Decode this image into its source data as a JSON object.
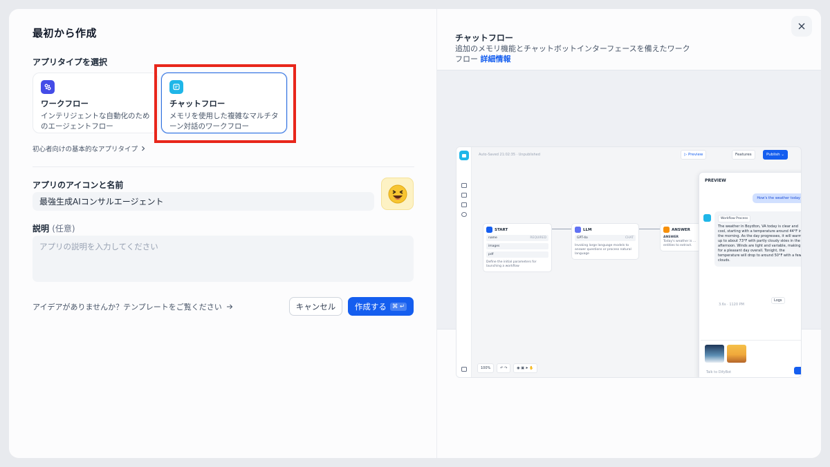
{
  "dialog": {
    "title": "最初から作成",
    "app_type_label": "アプリタイプを選択",
    "app_types": [
      {
        "name": "ワークフロー",
        "desc_line1": "インテリジェントな自動化のため",
        "desc_line2": "のエージェントフロー"
      },
      {
        "name": "チャットフロー",
        "desc_line1": "メモリを使用した複雑なマルチタ",
        "desc_line2": "ーン対話のワークフロー"
      }
    ],
    "beginner_link": "初心者向けの基本的なアプリタイプ",
    "icon_name_label": "アプリのアイコンと名前",
    "app_name_value": "最強生成AIコンサルエージェント",
    "emoji": "😆",
    "description_label": "説明",
    "description_optional": "(任意)",
    "description_placeholder": "アプリの説明を入力してください",
    "idea_link": "アイデアがありませんか？テンプレートをご覧ください",
    "cancel_label": "キャンセル",
    "create_label": "作成する",
    "create_shortcut": "⌘ ↵"
  },
  "preview": {
    "title": "チャットフロー",
    "desc": "追加のメモリ機能とチャットボットインターフェースを備えたワークフロー",
    "detail_link": "詳細情報",
    "mini_app": {
      "autosave": "Auto-Saved 21:02:35 · Unpublished",
      "preview_btn": "▷ Preview",
      "features_btn": "Features",
      "publish_btn": "Publish ⌄",
      "nodes": {
        "start": {
          "title": "START",
          "vars": [
            "name",
            "images",
            "pdf"
          ],
          "required": "REQUIRED",
          "desc": "Define the initial parameters for launching a workflow"
        },
        "llm": {
          "title": "LLM",
          "model": "GPT-4o",
          "mode": "CHAT",
          "desc": "Invoking large language models to answer questions or process natural language"
        },
        "answer": {
          "title": "ANSWER",
          "label": "ANSWER",
          "text": "Today's weather is ... entities to extract."
        }
      },
      "chat": {
        "header": "PREVIEW",
        "user_msg": "How's the weather today",
        "workflow_badge": "Workflow Process",
        "bot_msg": "The weather in Boydton, VA today is clear and cool, starting with a temperature around 44°F in the morning. As the day progresses, it will warm up to about 73°F with partly cloudy skies in the afternoon. Winds are light and variable, making for a pleasant day overall. Tonight, the temperature will drop to around 50°F with a few clouds.",
        "meta": "3.6s · 1120 PM",
        "logs": "Logs",
        "input_placeholder": "Talk to DifyBot"
      },
      "zoom": "100%"
    }
  },
  "colors": {
    "accent": "#155eef",
    "highlight": "#e8261b",
    "chatflow_icon": "#1fb6e8",
    "workflow_icon": "#444ce7"
  }
}
